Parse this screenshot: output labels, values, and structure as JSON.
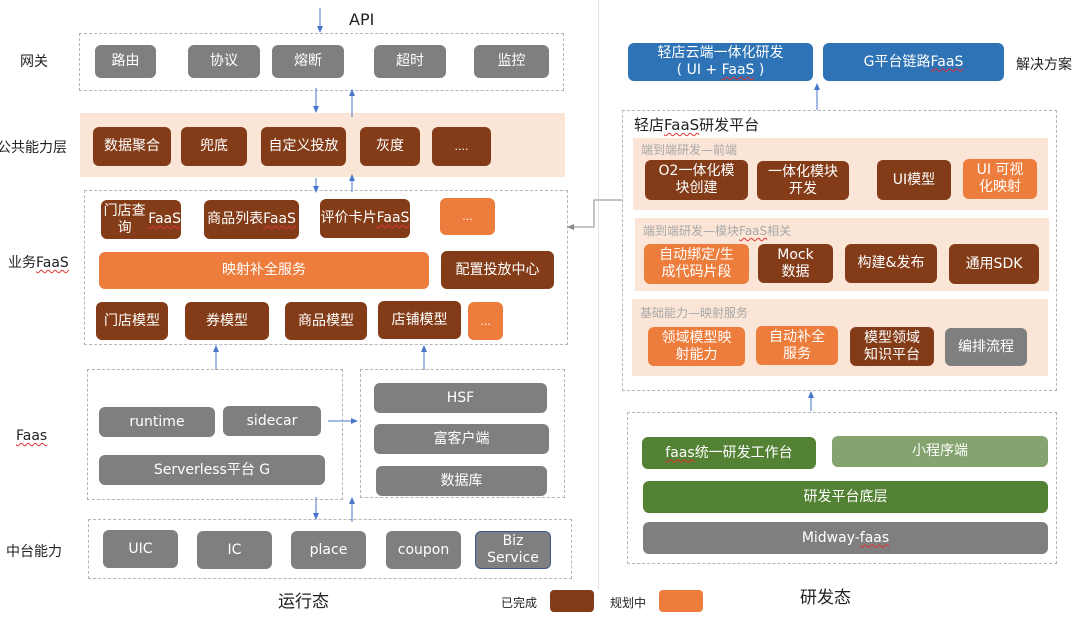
{
  "colors": {
    "done": "#843c18",
    "planned": "#ed7d3c",
    "infra": "#7f7f7f",
    "solution": "#2e73b6",
    "dev": "#548235",
    "dev_light": "#84a36f",
    "band": "#fbe5d6",
    "arrow": "#4a76c9"
  },
  "runtime": {
    "api_label": "API",
    "footer": "运行态",
    "layers": {
      "gateway": {
        "label": "网关",
        "items": [
          "路由",
          "协议",
          "熔断",
          "超时",
          "监控"
        ]
      },
      "common": {
        "label": "公共能力层",
        "items": [
          "数据聚合",
          "兜底",
          "自定义投放",
          "灰度",
          "...."
        ]
      },
      "business": {
        "label": "业务FaaS",
        "label_prefix": "业务",
        "label_suffix": "FaaS",
        "row1": [
          "门店查询",
          "商品列表",
          "评价卡片",
          "..."
        ],
        "row1_suffix": "FaaS",
        "mapping_service": "映射补全服务",
        "config_center": "配置投放中心",
        "models": [
          "门店模型",
          "券模型",
          "商品模型",
          "店铺模型",
          "..."
        ]
      },
      "faas": {
        "label": "Faas",
        "items": [
          "runtime",
          "sidecar",
          "Serverless平台 G"
        ],
        "deps": [
          "HSF",
          "富客户端",
          "数据库"
        ]
      },
      "middle": {
        "label": "中台能力",
        "items": [
          "UIC",
          "IC",
          "place",
          "coupon",
          "Biz\nService"
        ]
      }
    }
  },
  "devtime": {
    "footer": "研发态",
    "solutions_label": "解决方案",
    "solutions": [
      {
        "line1": "轻店云端一体化研发",
        "line2_prefix": "( UI + ",
        "line2_faas": "FaaS",
        "line2_suffix": " )"
      },
      {
        "prefix": "G平台链路",
        "faas": "FaaS"
      }
    ],
    "platform": {
      "title_prefix": "轻店",
      "title_faas": "FaaS",
      "title_suffix": "研发平台",
      "sections": [
        {
          "title": "端到端研发—前端",
          "items": [
            {
              "text": "O2一体化模\n块创建",
              "status": "done"
            },
            {
              "text": "一体化模块\n开发",
              "status": "done"
            },
            {
              "text": "UI模型",
              "status": "done"
            },
            {
              "text": "UI 可视\n化映射",
              "status": "planned"
            }
          ]
        },
        {
          "title_prefix": "端到端研发—模块",
          "title_faas": "FaaS",
          "title_suffix": "相关",
          "items": [
            {
              "text": "自动绑定/生\n成代码片段",
              "status": "planned"
            },
            {
              "text": "Mock\n数据",
              "status": "done"
            },
            {
              "text": "构建&发布",
              "status": "done"
            },
            {
              "text": "通用SDK",
              "status": "done"
            }
          ]
        },
        {
          "title": "基础能力—映射服务",
          "items": [
            {
              "text": "领域模型映\n射能力",
              "status": "planned"
            },
            {
              "text": "自动补全\n服务",
              "status": "planned"
            },
            {
              "text": "模型领域\n知识平台",
              "status": "done"
            },
            {
              "text": "编排流程",
              "status": "infra"
            }
          ]
        }
      ]
    },
    "base": {
      "workbench_faas": "faas",
      "workbench_suffix": "统一研发工作台",
      "miniprogram": "小程序端",
      "platform_base": "研发平台底层",
      "midway_prefix": "Midway-",
      "midway_faas": "faas"
    }
  },
  "legend": {
    "done": "已完成",
    "planned": "规划中"
  }
}
